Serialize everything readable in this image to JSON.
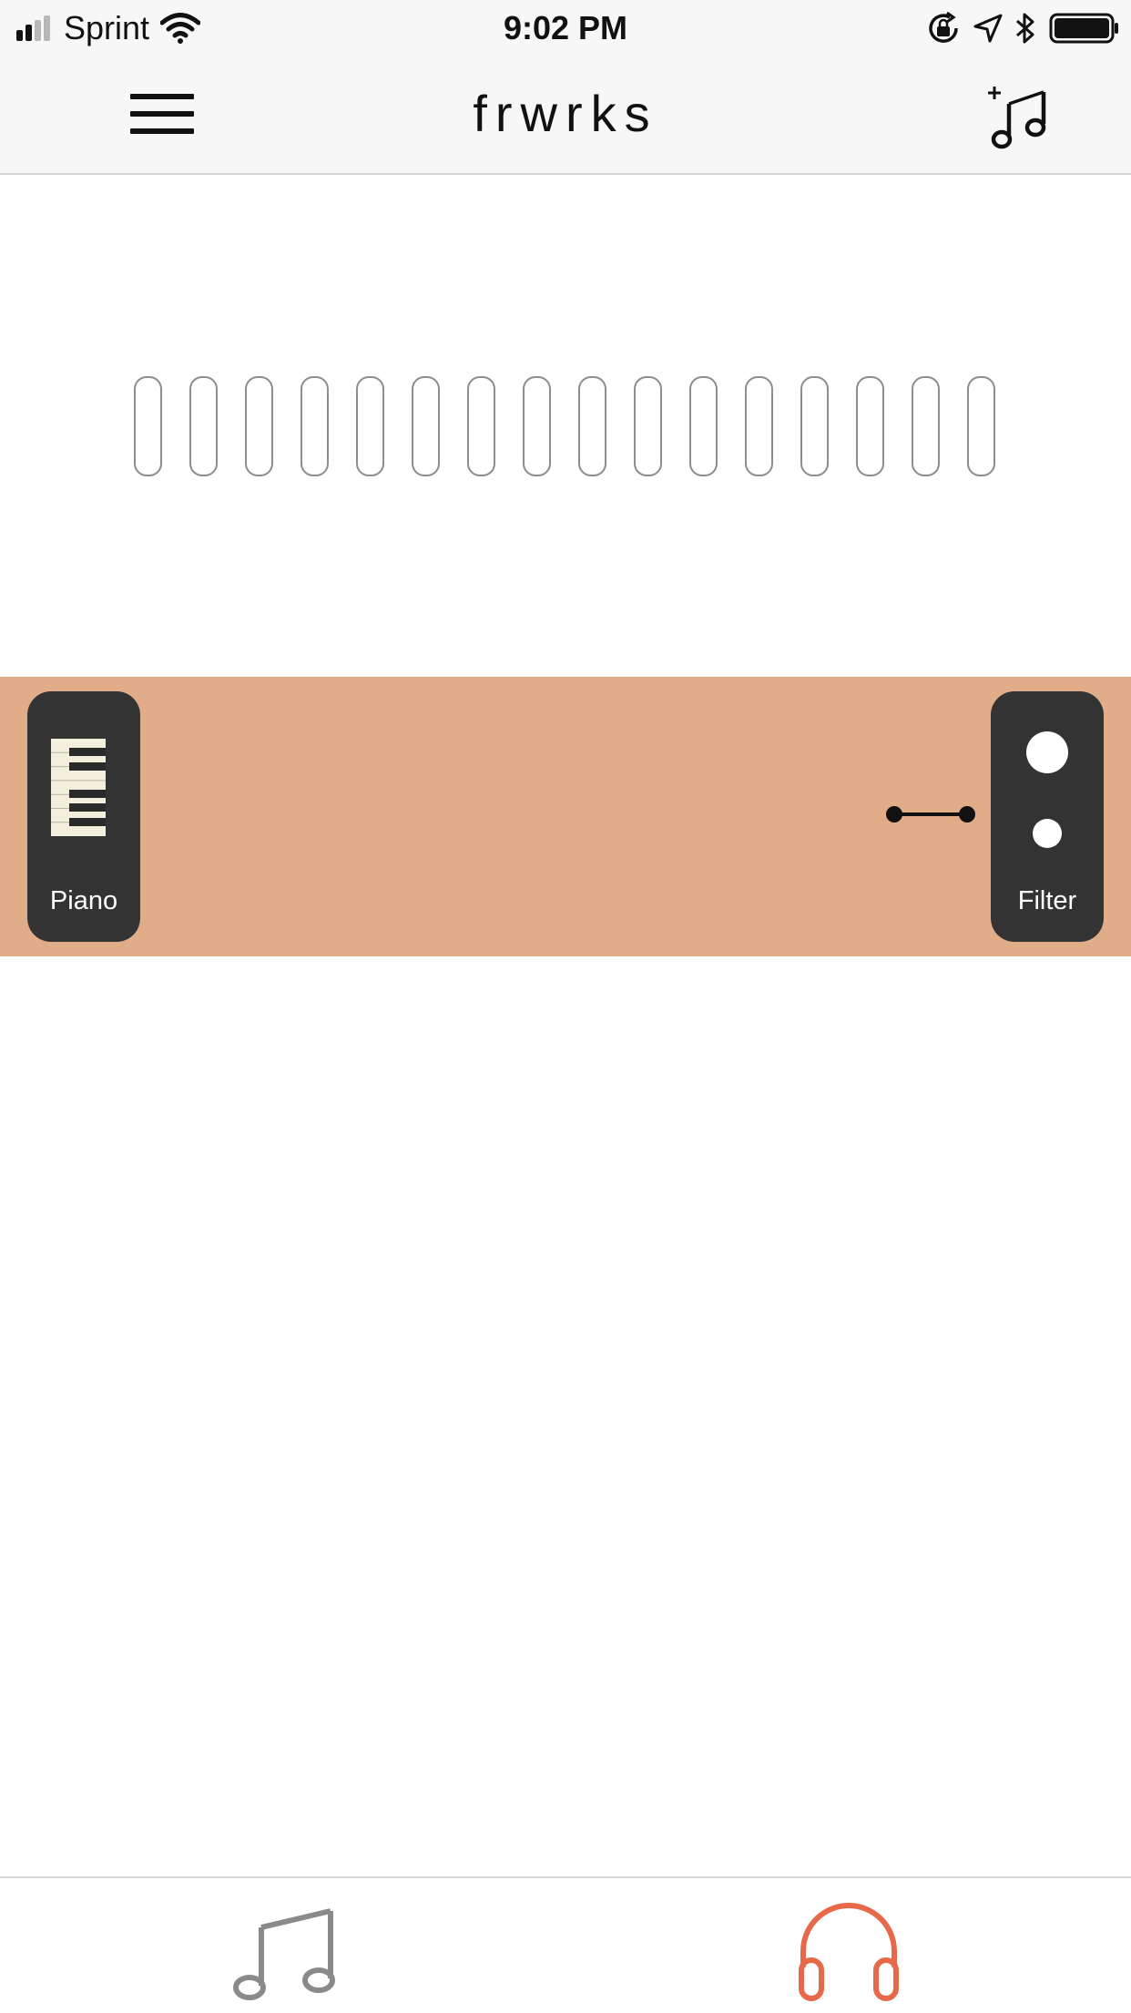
{
  "status_bar": {
    "carrier": "Sprint",
    "time": "9:02 PM",
    "signal_bars_filled": 2,
    "signal_bars_total": 4,
    "icons": [
      "signal-icon",
      "wifi-icon",
      "orientation-lock-icon",
      "location-icon",
      "bluetooth-icon",
      "battery-icon"
    ],
    "battery_level": 1.0
  },
  "nav_bar": {
    "title": "frwrks",
    "left_icon": "hamburger-menu-icon",
    "right_icon": "add-music-note-icon"
  },
  "sequencer": {
    "steps": [
      {
        "active": false
      },
      {
        "active": false
      },
      {
        "active": false
      },
      {
        "active": false
      },
      {
        "active": false
      },
      {
        "active": false
      },
      {
        "active": false
      },
      {
        "active": false
      },
      {
        "active": false
      },
      {
        "active": false
      },
      {
        "active": false
      },
      {
        "active": false
      },
      {
        "active": false
      },
      {
        "active": false
      },
      {
        "active": false
      },
      {
        "active": false
      }
    ]
  },
  "instrument_strip": {
    "background_color": "#e1ad89",
    "source": {
      "label": "Piano",
      "icon": "piano-keyboard-icon"
    },
    "connector_icon": "connector-line-icon",
    "effect": {
      "label": "Filter",
      "icon": "filter-dots-icon"
    }
  },
  "tab_bar": {
    "tabs": [
      {
        "name": "songs",
        "icon": "music-note-icon",
        "color": "#8a8a8a",
        "active": false
      },
      {
        "name": "listen",
        "icon": "headphones-icon",
        "color": "#e8684a",
        "active": true
      }
    ]
  }
}
